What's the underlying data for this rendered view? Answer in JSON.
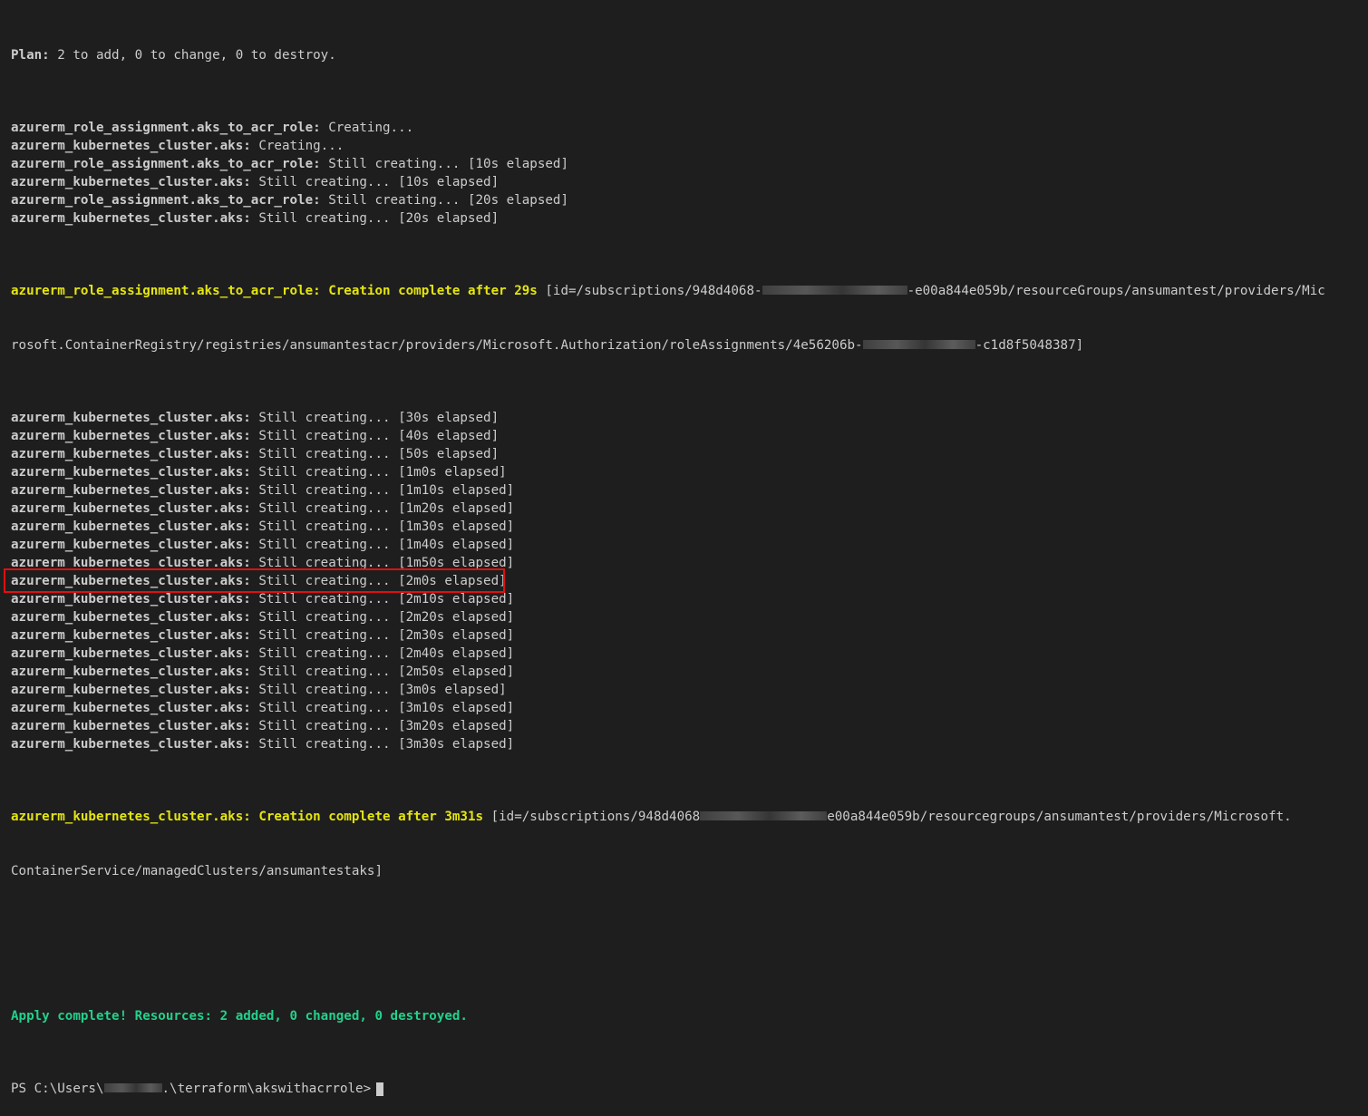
{
  "terminal": {
    "plan": {
      "label": "Plan:",
      "text": " 2 to add, 0 to change, 0 to destroy."
    },
    "lines_a": [
      {
        "res": "azurerm_role_assignment.aks_to_acr_role:",
        "msg": " Creating..."
      },
      {
        "res": "azurerm_kubernetes_cluster.aks:",
        "msg": " Creating..."
      },
      {
        "res": "azurerm_role_assignment.aks_to_acr_role:",
        "msg": " Still creating... [10s elapsed]"
      },
      {
        "res": "azurerm_kubernetes_cluster.aks:",
        "msg": " Still creating... [10s elapsed]"
      },
      {
        "res": "azurerm_role_assignment.aks_to_acr_role:",
        "msg": " Still creating... [20s elapsed]"
      },
      {
        "res": "azurerm_kubernetes_cluster.aks:",
        "msg": " Still creating... [20s elapsed]"
      }
    ],
    "role_complete": {
      "highlight": "azurerm_role_assignment.aks_to_acr_role: Creation complete after 29s",
      "id_part1": " [id=/subscriptions/948d4068-",
      "id_part2": "-e00a844e059b/resourceGroups/ansumantest/providers/Mic",
      "wrap_part1": "rosoft.ContainerRegistry/registries/ansumantestacr/providers/Microsoft.Authorization/roleAssignments/4e56206b-",
      "wrap_part2": "-c1d8f5048387]"
    },
    "lines_b": [
      {
        "res": "azurerm_kubernetes_cluster.aks:",
        "msg": " Still creating... [30s elapsed]"
      },
      {
        "res": "azurerm_kubernetes_cluster.aks:",
        "msg": " Still creating... [40s elapsed]"
      },
      {
        "res": "azurerm_kubernetes_cluster.aks:",
        "msg": " Still creating... [50s elapsed]"
      },
      {
        "res": "azurerm_kubernetes_cluster.aks:",
        "msg": " Still creating... [1m0s elapsed]"
      },
      {
        "res": "azurerm_kubernetes_cluster.aks:",
        "msg": " Still creating... [1m10s elapsed]"
      },
      {
        "res": "azurerm_kubernetes_cluster.aks:",
        "msg": " Still creating... [1m20s elapsed]"
      },
      {
        "res": "azurerm_kubernetes_cluster.aks:",
        "msg": " Still creating... [1m30s elapsed]"
      },
      {
        "res": "azurerm_kubernetes_cluster.aks:",
        "msg": " Still creating... [1m40s elapsed]"
      },
      {
        "res": "azurerm_kubernetes_cluster.aks:",
        "msg": " Still creating... [1m50s elapsed]"
      },
      {
        "res": "azurerm_kubernetes_cluster.aks:",
        "msg": " Still creating... [2m0s elapsed]"
      },
      {
        "res": "azurerm_kubernetes_cluster.aks:",
        "msg": " Still creating... [2m10s elapsed]"
      },
      {
        "res": "azurerm_kubernetes_cluster.aks:",
        "msg": " Still creating... [2m20s elapsed]"
      },
      {
        "res": "azurerm_kubernetes_cluster.aks:",
        "msg": " Still creating... [2m30s elapsed]"
      },
      {
        "res": "azurerm_kubernetes_cluster.aks:",
        "msg": " Still creating... [2m40s elapsed]"
      },
      {
        "res": "azurerm_kubernetes_cluster.aks:",
        "msg": " Still creating... [2m50s elapsed]"
      },
      {
        "res": "azurerm_kubernetes_cluster.aks:",
        "msg": " Still creating... [3m0s elapsed]"
      },
      {
        "res": "azurerm_kubernetes_cluster.aks:",
        "msg": " Still creating... [3m10s elapsed]"
      },
      {
        "res": "azurerm_kubernetes_cluster.aks:",
        "msg": " Still creating... [3m20s elapsed]"
      },
      {
        "res": "azurerm_kubernetes_cluster.aks:",
        "msg": " Still creating... [3m30s elapsed]"
      }
    ],
    "aks_complete": {
      "highlight": "azurerm_kubernetes_cluster.aks: Creation complete after 3m31s",
      "id_part1": " [id=/subscriptions/948d4068",
      "id_part2": "e00a844e059b/resourcegroups/ansumantest/providers/Microsoft.",
      "wrap": "ContainerService/managedClusters/ansumantestaks]"
    },
    "apply": "Apply complete! Resources: 2 added, 0 changed, 0 destroyed.",
    "prompt": {
      "prefix": "PS C:\\Users\\",
      "suffix": ".\\terraform\\akswithacrrole>"
    },
    "colors": {
      "background": "#1e1e1e",
      "text": "#cccccc",
      "highlight_yellow": "#e5e510",
      "success_green": "#23d18b",
      "box_red": "#e01010"
    }
  }
}
